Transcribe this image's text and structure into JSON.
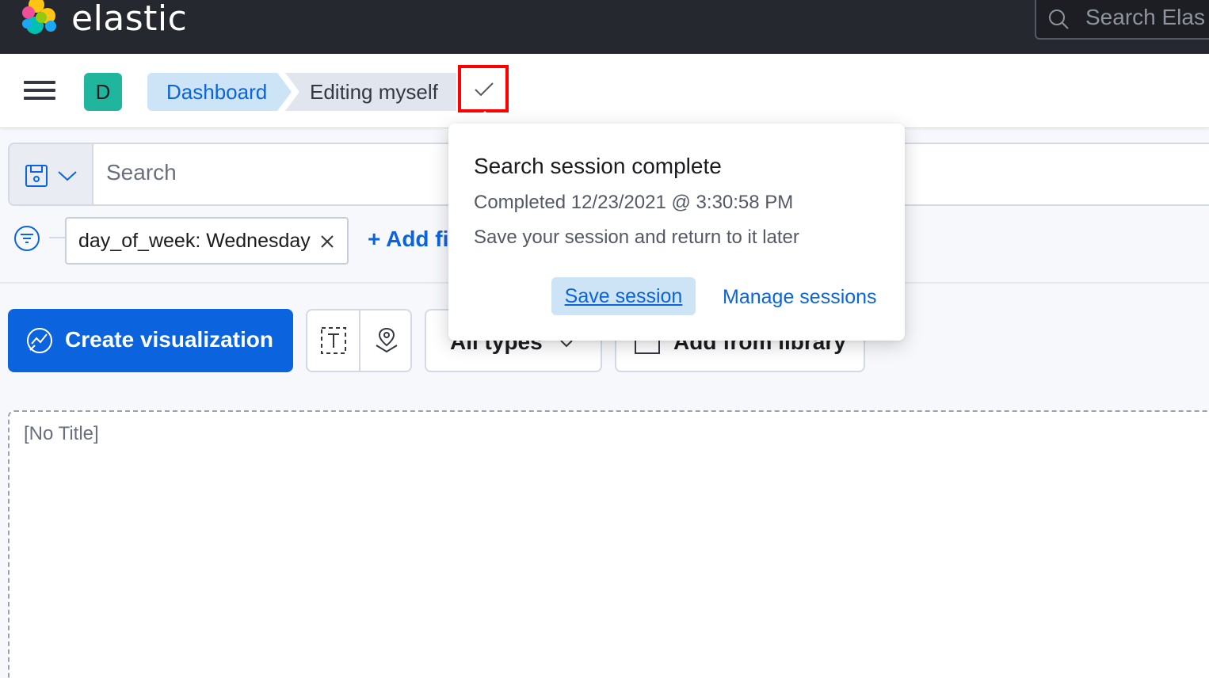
{
  "header": {
    "brand": "elastic",
    "global_search_placeholder": "Search Elas"
  },
  "breadcrumbs": {
    "space_initial": "D",
    "items": [
      "Dashboard",
      "Editing myself"
    ]
  },
  "query_bar": {
    "placeholder": "Search"
  },
  "filters": {
    "items": [
      "day_of_week: Wednesday"
    ],
    "add_label": "+ Add fi"
  },
  "toolbar": {
    "create_label": "Create visualization",
    "all_types_label": "All types",
    "add_library_label": "Add from library"
  },
  "panel": {
    "title": "[No Title]"
  },
  "popover": {
    "title": "Search session complete",
    "completed": "Completed 12/23/2021 @ 3:30:58 PM",
    "hint": "Save your session and return to it later",
    "save_label": "Save session",
    "manage_label": "Manage sessions"
  },
  "colors": {
    "accent": "#0b64dd",
    "header_bg": "#25282f",
    "space_avatar": "#20b69e",
    "highlight_box": "#ff0000"
  },
  "icons": [
    "elastic-logo-icon",
    "search-icon",
    "menu-icon",
    "check-icon",
    "save-icon",
    "chevron-down-icon",
    "filter-icon",
    "close-icon",
    "visualize-icon",
    "text-icon",
    "map-icon"
  ]
}
